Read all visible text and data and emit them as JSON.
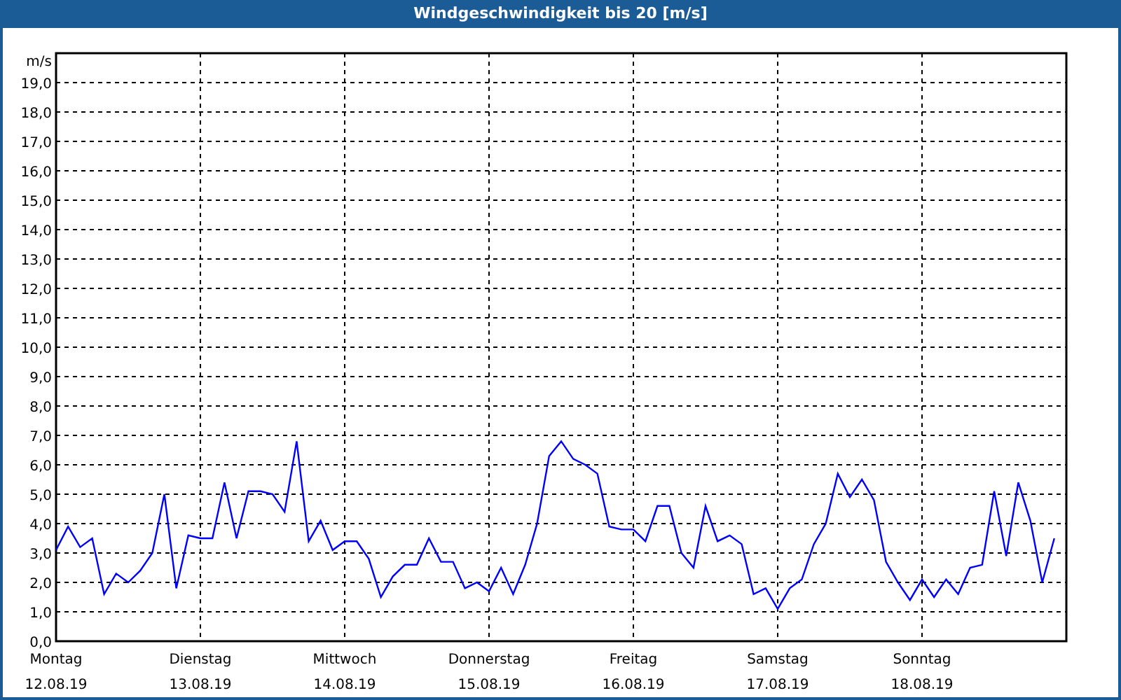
{
  "window": {
    "title": "Windgeschwindigkeit bis 20 [m/s]"
  },
  "chart": {
    "dates": [
      "12.08.19",
      "13.08.19",
      "14.08.19",
      "15.08.19",
      "16.08.19",
      "17.08.19",
      "18.08.19"
    ],
    "chart_data": {
      "type": "line",
      "ylabel": "m/s",
      "ylim": [
        0,
        20
      ],
      "grid": true,
      "categories": [
        "Montag",
        null,
        null,
        null,
        null,
        null,
        null,
        null,
        null,
        null,
        null,
        null,
        "Dienstag",
        null,
        null,
        null,
        null,
        null,
        null,
        null,
        null,
        null,
        null,
        null,
        "Mittwoch",
        null,
        null,
        null,
        null,
        null,
        null,
        null,
        null,
        null,
        null,
        null,
        "Donnerstag",
        null,
        null,
        null,
        null,
        null,
        null,
        null,
        null,
        null,
        null,
        null,
        "Freitag",
        null,
        null,
        null,
        null,
        null,
        null,
        null,
        null,
        null,
        null,
        null,
        "Samstag",
        null,
        null,
        null,
        null,
        null,
        null,
        null,
        null,
        null,
        null,
        null,
        "Sonntag",
        null,
        null,
        null,
        null,
        null,
        null,
        null,
        null,
        null,
        null,
        null
      ],
      "yticks": [
        {
          "value": 0,
          "label": "0,0"
        },
        {
          "value": 1,
          "label": "1,0"
        },
        {
          "value": 2,
          "label": "2,0"
        },
        {
          "value": 3,
          "label": "3,0"
        },
        {
          "value": 4,
          "label": "4,0"
        },
        {
          "value": 5,
          "label": "5,0"
        },
        {
          "value": 6,
          "label": "6,0"
        },
        {
          "value": 7,
          "label": "7,0"
        },
        {
          "value": 8,
          "label": "8,0"
        },
        {
          "value": 9,
          "label": "9,0"
        },
        {
          "value": 10,
          "label": "10,0"
        },
        {
          "value": 11,
          "label": "11,0"
        },
        {
          "value": 12,
          "label": "12,0"
        },
        {
          "value": 13,
          "label": "13,0"
        },
        {
          "value": 14,
          "label": "14,0"
        },
        {
          "value": 15,
          "label": "15,0"
        },
        {
          "value": 16,
          "label": "16,0"
        },
        {
          "value": 17,
          "label": "17,0"
        },
        {
          "value": 18,
          "label": "18,0"
        },
        {
          "value": 19,
          "label": "19,0"
        }
      ],
      "series": [
        {
          "color": "#0000ff",
          "values": [
            3.1,
            3.9,
            3.2,
            3.5,
            1.6,
            2.3,
            2.0,
            2.4,
            3.0,
            5.0,
            1.8,
            3.6,
            3.5,
            3.5,
            5.4,
            3.5,
            5.1,
            5.1,
            5.0,
            4.4,
            6.8,
            3.4,
            4.1,
            3.1,
            3.4,
            3.4,
            2.8,
            1.5,
            2.2,
            2.6,
            2.6,
            3.5,
            2.7,
            2.7,
            1.8,
            2.0,
            1.7,
            2.5,
            1.6,
            2.6,
            4.0,
            6.3,
            6.8,
            6.2,
            6.0,
            5.7,
            3.9,
            3.8,
            3.8,
            3.4,
            4.6,
            4.6,
            3.0,
            2.5,
            4.6,
            3.4,
            3.6,
            3.3,
            1.6,
            1.8,
            1.1,
            1.8,
            2.1,
            3.3,
            4.0,
            5.7,
            4.9,
            5.5,
            4.8,
            2.7,
            2.0,
            1.4,
            2.1,
            1.5,
            2.1,
            1.6,
            2.5,
            2.6,
            5.1,
            2.9,
            5.4,
            4.1,
            2.0,
            3.5
          ]
        }
      ]
    }
  }
}
